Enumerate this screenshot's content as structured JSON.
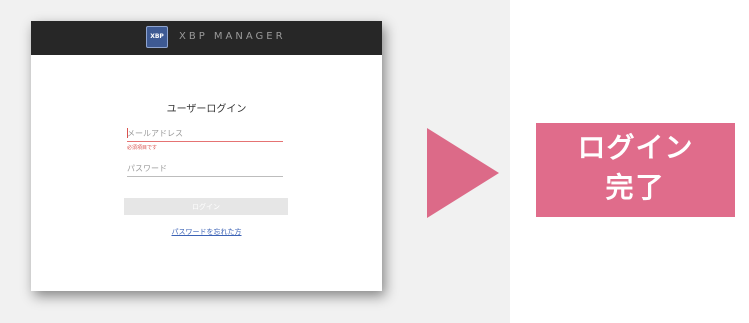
{
  "window": {
    "logo_text": "XBP",
    "app_title": "XBP MANAGER"
  },
  "login_form": {
    "heading": "ユーザーログイン",
    "email": {
      "placeholder": "メールアドレス",
      "value": "",
      "error": "必須項目です"
    },
    "password": {
      "placeholder": "パスワード",
      "value": ""
    },
    "login_button_label": "ログイン",
    "forgot_password_link": "パスワードを忘れた方"
  },
  "result": {
    "line1": "ログイン",
    "line2": "完了"
  },
  "colors": {
    "accent_pink": "#e06c8b",
    "arrow_pink": "#dc6a88",
    "titlebar": "#272727",
    "error_red": "#d9534f",
    "link_blue": "#3b62b5"
  },
  "icons": {
    "arrow": "right-triangle-arrow-icon",
    "logo": "xbp-logo-icon"
  }
}
